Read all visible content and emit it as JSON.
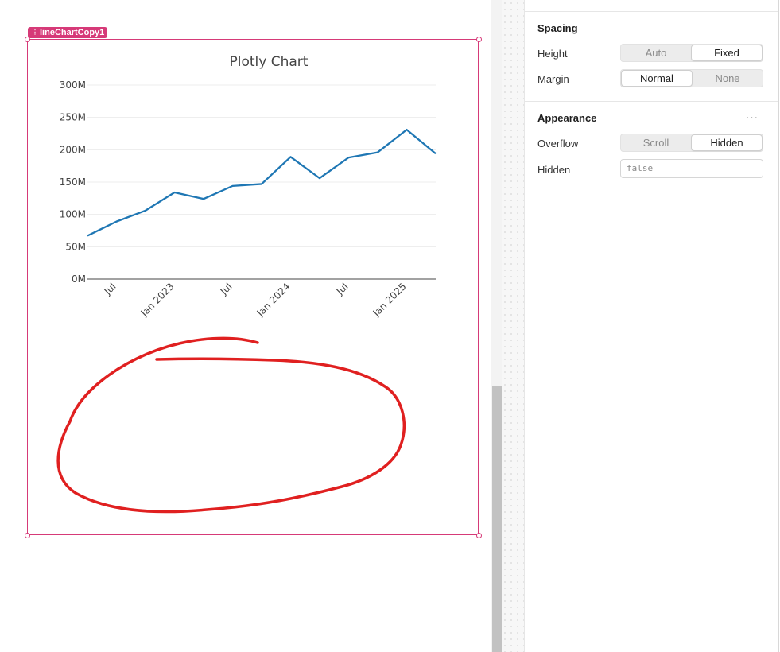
{
  "component": {
    "name": "lineChartCopy1"
  },
  "chart_data": {
    "type": "line",
    "title": "Plotly Chart",
    "x": [
      "2022-04",
      "2022-07",
      "2022-10",
      "2023-01",
      "2023-04",
      "2023-07",
      "2023-10",
      "2024-01",
      "2024-04",
      "2024-07",
      "2024-10",
      "2025-01",
      "2025-04"
    ],
    "series": [
      {
        "values": [
          67,
          89,
          106,
          134,
          124,
          144,
          147,
          189,
          156,
          188,
          196,
          231,
          194
        ]
      }
    ],
    "ylim": [
      0,
      300
    ],
    "y_ticks": [
      "0M",
      "50M",
      "100M",
      "150M",
      "200M",
      "250M",
      "300M"
    ],
    "x_ticks": [
      "Jul",
      "Jan 2023",
      "Jul",
      "Jan 2024",
      "Jul",
      "Jan 2025"
    ],
    "y_unit": "M",
    "line_color": "#1f77b4",
    "grid": true
  },
  "panel": {
    "spacing": {
      "title": "Spacing",
      "height_label": "Height",
      "height_options": [
        "Auto",
        "Fixed"
      ],
      "height_selected": "Fixed",
      "margin_label": "Margin",
      "margin_options": [
        "Normal",
        "None"
      ],
      "margin_selected": "Normal"
    },
    "appearance": {
      "title": "Appearance",
      "more_label": "···",
      "overflow_label": "Overflow",
      "overflow_options": [
        "Scroll",
        "Hidden"
      ],
      "overflow_selected": "Hidden",
      "hidden_label": "Hidden",
      "hidden_value": "false"
    }
  },
  "colors": {
    "selection": "#d63a78",
    "annotation": "#e02020",
    "line": "#1f77b4"
  }
}
